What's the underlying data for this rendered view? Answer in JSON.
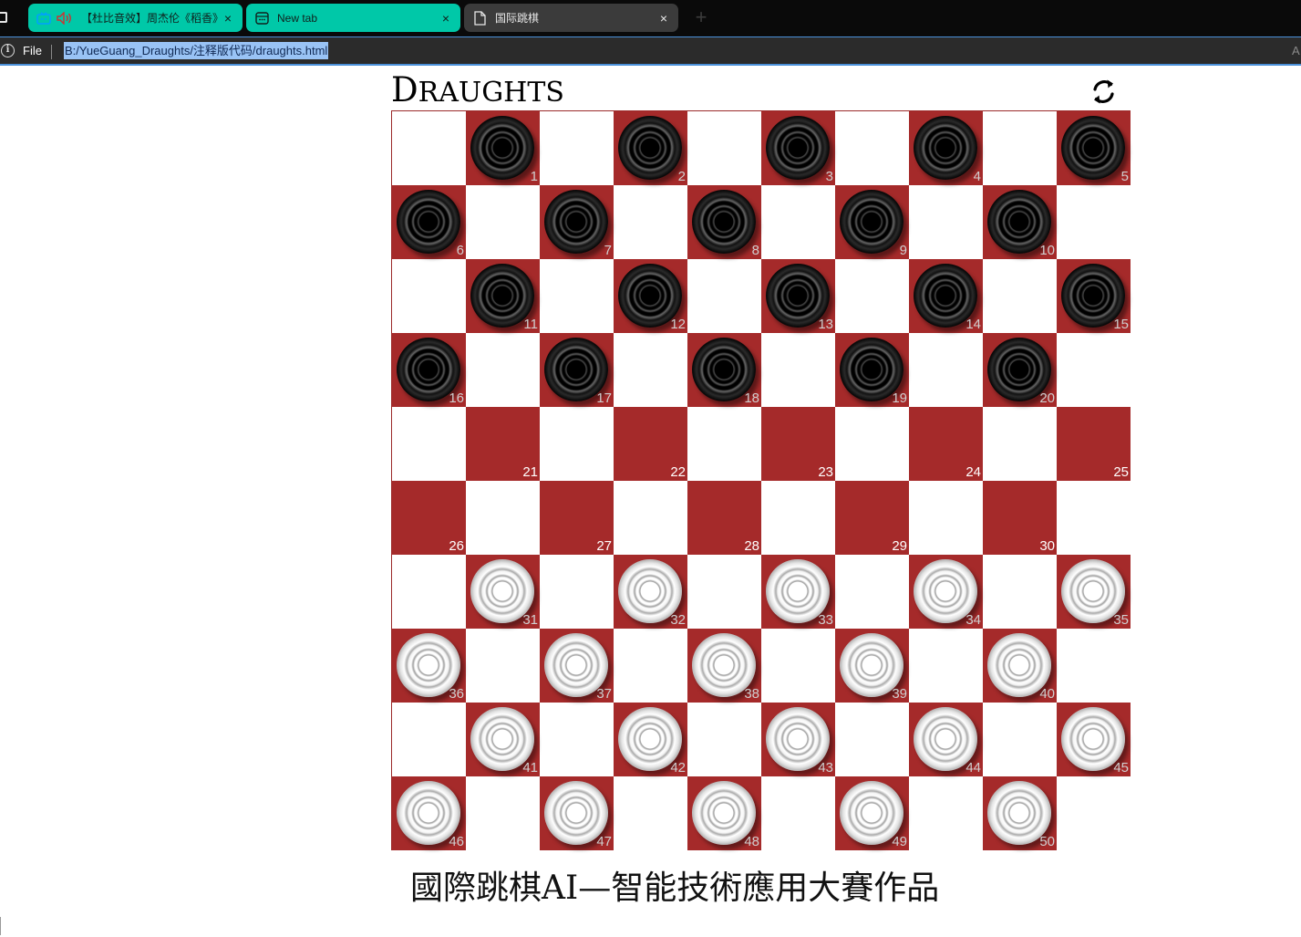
{
  "browser": {
    "tabs": [
      {
        "title": "【杜比音效】周杰伦《稻香》[ï¿½",
        "favicon": "tv-icon",
        "audio": true,
        "active": false
      },
      {
        "title": "New tab",
        "favicon": "calendar-icon",
        "active": false
      },
      {
        "title": "国际跳棋",
        "favicon": "document-icon",
        "active": true
      }
    ],
    "close_glyph": "×",
    "new_tab_glyph": "+",
    "address": {
      "scheme_label": "File",
      "url": "B:/YueGuang_Draughts/注释版代码/draughts.html",
      "edge_char": "A"
    }
  },
  "page": {
    "title_first": "D",
    "title_rest": "RAUGHTS",
    "reset_icon": "refresh-icon",
    "footer": "國際跳棋AI—智能技術應用大賽作品"
  },
  "board": {
    "size": 10,
    "colors": {
      "light": "#ffffff",
      "dark": "#a52a2a",
      "number": "#ffffff"
    },
    "black_squares": [
      1,
      2,
      3,
      4,
      5,
      6,
      7,
      8,
      9,
      10,
      11,
      12,
      13,
      14,
      15,
      16,
      17,
      18,
      19,
      20
    ],
    "white_squares": [
      31,
      32,
      33,
      34,
      35,
      36,
      37,
      38,
      39,
      40,
      41,
      42,
      43,
      44,
      45,
      46,
      47,
      48,
      49,
      50
    ],
    "empty_squares": [
      21,
      22,
      23,
      24,
      25,
      26,
      27,
      28,
      29,
      30
    ]
  }
}
